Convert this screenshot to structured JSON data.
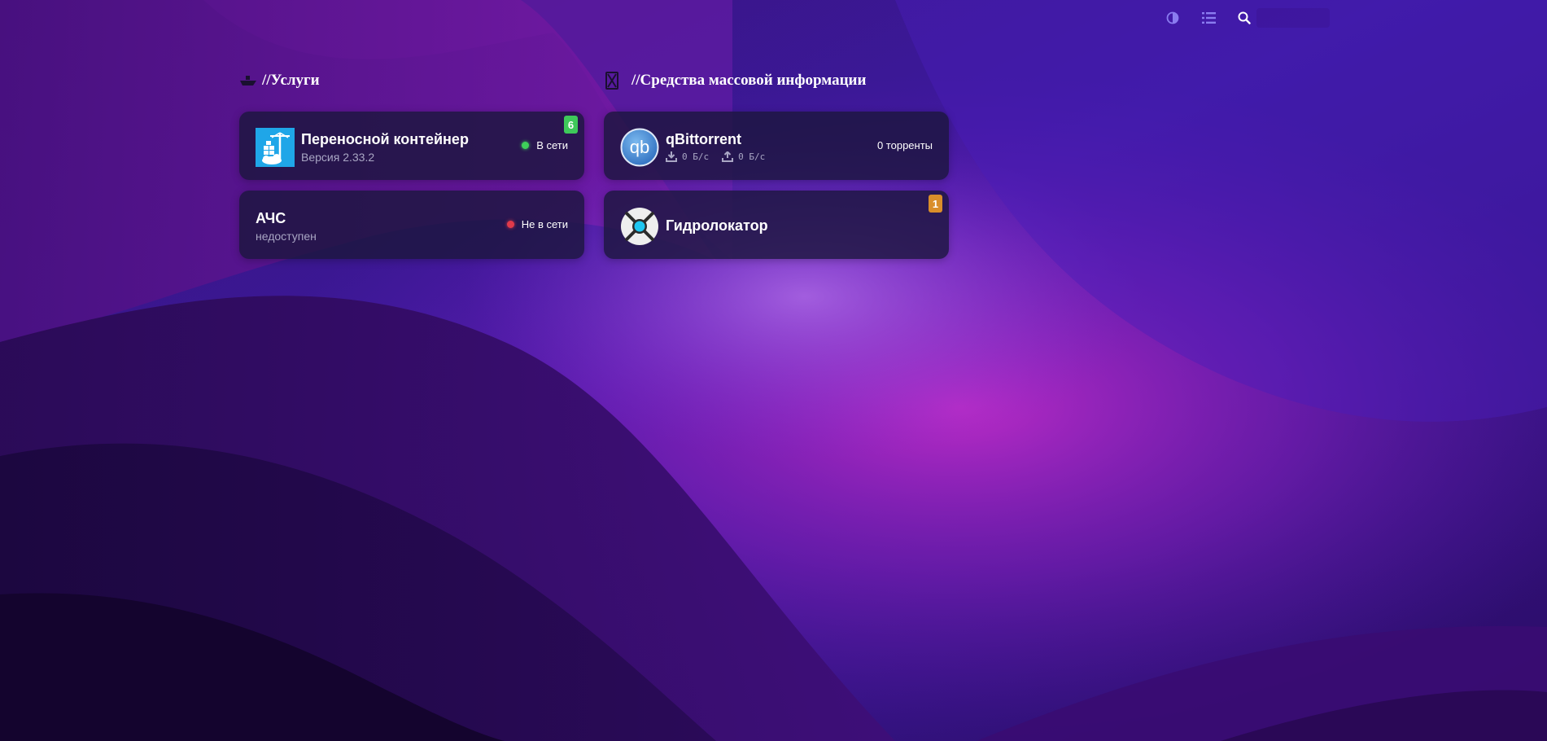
{
  "toolbar": {
    "icons": [
      "theme-toggle-icon",
      "list-view-icon",
      "search-icon"
    ],
    "search_value": "",
    "search_placeholder": ""
  },
  "groups": [
    {
      "title": "//Услуги",
      "icon": "ship-icon",
      "cards": [
        {
          "title": "Переносной контейнер",
          "subtitle": "Версия 2.33.2",
          "status": "В сети",
          "status_color": "#3ecf5a",
          "badge": "6",
          "badge_color": "#3ec95a",
          "logo": "portainer-logo"
        },
        {
          "title": "АЧС",
          "subtitle": "недоступен",
          "status": "Не в сети",
          "status_color": "#e03a4a",
          "logo": ""
        }
      ]
    },
    {
      "title": "//Средства массовой информации",
      "icon": "media-icon",
      "cards": [
        {
          "title": "qBittorrent",
          "status": "0 торренты",
          "download": "0 Б/с",
          "upload": "0 Б/с",
          "logo": "qbittorrent-logo",
          "logo_text": "qb"
        },
        {
          "title": "Гидролокатор",
          "badge": "1",
          "badge_color": "#d98e2a",
          "logo": "sonarr-logo"
        }
      ]
    }
  ],
  "colors": {
    "card_bg": "#1c163e",
    "muted_text": "#a9a6c4",
    "accent": "#8a7cf0"
  }
}
